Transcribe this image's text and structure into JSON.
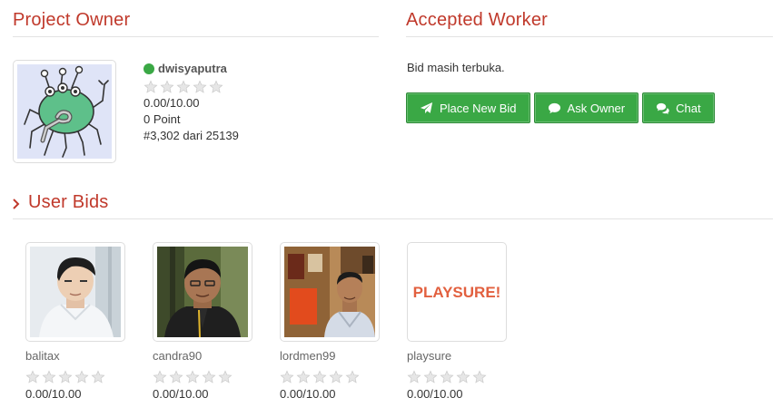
{
  "owner_section": {
    "title": "Project Owner",
    "username": "dwisyaputra",
    "online_status_color": "#3aa845",
    "stars": 5,
    "rating": "0.00/10.00",
    "points": "0 Point",
    "rank": "#3,302 dari 25139"
  },
  "worker_section": {
    "title": "Accepted Worker",
    "bid_status": "Bid masih terbuka.",
    "buttons": {
      "place_bid": {
        "label": "Place New Bid",
        "icon": "paper-plane-icon"
      },
      "ask_owner": {
        "label": "Ask Owner",
        "icon": "comment-icon"
      },
      "chat": {
        "label": "Chat",
        "icon": "comments-icon"
      }
    },
    "button_color": "#3aa845"
  },
  "bids_section": {
    "title": "User Bids",
    "bidders": [
      {
        "username": "balitax",
        "rating": "0.00/10.00"
      },
      {
        "username": "candra90",
        "rating": "0.00/10.00"
      },
      {
        "username": "lordmen99",
        "rating": "0.00/10.00"
      },
      {
        "username": "playsure",
        "rating": "0.00/10.00",
        "logo_text": "PLAYSURE!"
      }
    ]
  },
  "accent_color": "#c0392b"
}
